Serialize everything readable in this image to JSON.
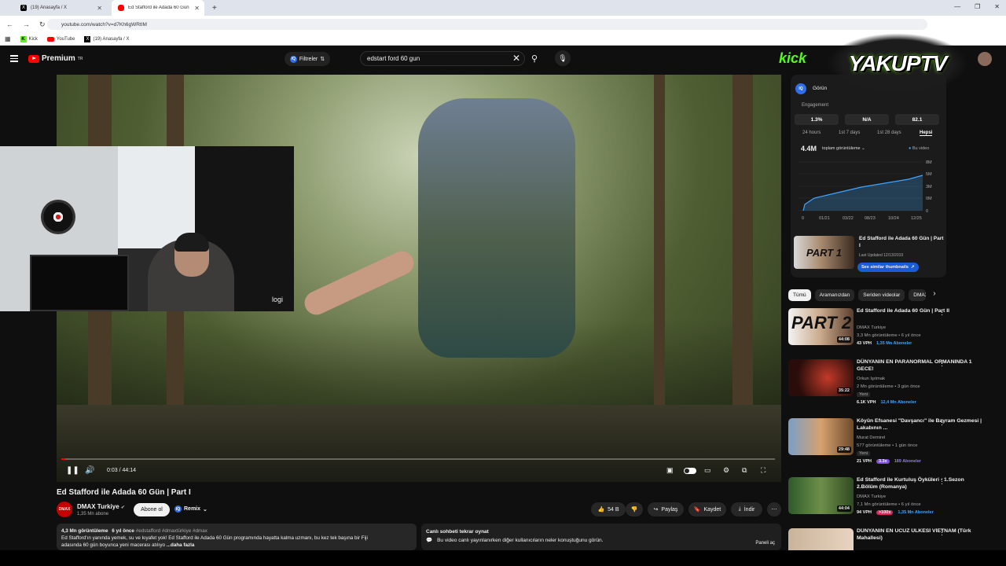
{
  "browser": {
    "tabs": [
      {
        "title": "(19) Anasayfa / X"
      },
      {
        "title": "Ed Stafford ile Adada 60 Gün"
      }
    ],
    "url": "youtube.com/watch?v=d7Kh6gWRtIM",
    "bookmarks": [
      "Kick",
      "YouTube",
      "(19) Anasayfa / X"
    ]
  },
  "header": {
    "brand": "Premium",
    "brand_sup": "TR",
    "filters_label": "Filtreler",
    "search_value": "edstart ford 60 gun"
  },
  "player": {
    "current_time": "0:03 / 44:14",
    "progress_fraction": 0.001,
    "webcam_brand": "logi"
  },
  "video": {
    "title": "Ed Stafford ile Adada 60 Gün | Part I",
    "channel": "DMAX Turkiye",
    "channel_avatar": "DMAX",
    "subscribers": "1,35 Mn abone",
    "subscribe_label": "Abone ol",
    "remix_label": "Remix",
    "likes": "54 B",
    "share_label": "Paylaş",
    "save_label": "Kaydet",
    "download_label": "İndir"
  },
  "description": {
    "views": "4,3 Mn görüntüleme",
    "age": "6 yıl önce",
    "tags": "#edstafford #dmaxtürkiye #dmax",
    "text": "Ed Stafford'ın yanında yemek, su ve kıyafet yok! Ed Stafford ile Adada 60 Gün programında hayatta kalma uzmanı, bu kez tek başına bir Fiji",
    "text2": "adasında 60 gün boyunca yeni macerası atılıyo",
    "more": "...daha fazla"
  },
  "chat": {
    "title": "Canlı sohbeti tekrar oynat",
    "text": "Bu video canlı yayınlanırken diğer kullanıcıların neler konuştuğunu görün.",
    "panel_label": "Paneli aç"
  },
  "overlay": {
    "kick": "kick",
    "yakup": "YAKUPTV"
  },
  "analytics": {
    "label": "Görün",
    "engagement_label": "Engagement",
    "stats": [
      "1.3%",
      "N/A",
      "82.1"
    ],
    "periods": [
      "24 hours",
      "1st 7 days",
      "1st 28 days",
      "Hepsi"
    ],
    "total_views": "4.4M",
    "total_label": "toplam görüntüleme",
    "legend_label": "Bu video",
    "y_ticks": [
      "8M",
      "5M",
      "3M",
      "0M",
      "0"
    ],
    "x_ticks": [
      "0",
      "01/21",
      "03/22",
      "08/23",
      "10/24",
      "12/25"
    ],
    "thumb_title": "Ed Stafford ile Adada 60 Gün | Part I",
    "updated": "Last Updated 12/13/2019",
    "similar_label": "See similar thumbnails",
    "thumb_text": "PART 1"
  },
  "chips": [
    "Tümü",
    "Aramanızdan",
    "Seriden videolar",
    "DMAX"
  ],
  "recommendations": [
    {
      "title": "Ed Stafford ile Adada 60 Gün | Part II",
      "channel": "DMAX Turkiye",
      "meta": "3,3 Mn görüntüleme • 6 yıl önce",
      "vph": "43 VPH",
      "subs": "1,35 Mn Aboneler",
      "duration": "44:08",
      "thumb_text": "PART 2",
      "badge": ""
    },
    {
      "title": "DÜNYANIN EN PARANORMAL ORMANINDA 1 GECE!",
      "channel": "Orkun Işıtmak",
      "meta": "2 Mn görüntüleme • 3 gün önce",
      "vph": "6.1K VPH",
      "subs": "12,4 Mn Aboneler",
      "duration": "35:22",
      "thumb_text": "",
      "badge": "Yeni"
    },
    {
      "title": "Köyün Efsanesi \"Davşancı\" ile Bayram Gezmesi | Lakabının ...",
      "channel": "Murat Demirel",
      "meta": "577 görüntüleme • 1 gün önce",
      "vph": "21 VPH",
      "subs": "189 Aboneler",
      "duration": "29:48",
      "thumb_text": "",
      "badge": "Yeni",
      "mult": "3.3x"
    },
    {
      "title": "Ed Stafford ile Kurtuluş Öyküleri - 1.Sezon 2.Bölüm (Romanya)",
      "channel": "DMAX Turkiye",
      "meta": "7,1 Mn görüntüleme • 6 yıl önce",
      "vph": "94 VPH",
      "subs": "1,35 Mn Aboneler",
      "duration": "44:04",
      "thumb_text": "",
      "badge": "",
      "mult": ">100x"
    },
    {
      "title": "DÜNYANIN EN UCUZ ÜLKESİ VİETNAM (Türk Mahallesi)",
      "channel": "",
      "meta": "",
      "vph": "",
      "subs": "",
      "duration": "",
      "thumb_text": "",
      "badge": ""
    }
  ]
}
